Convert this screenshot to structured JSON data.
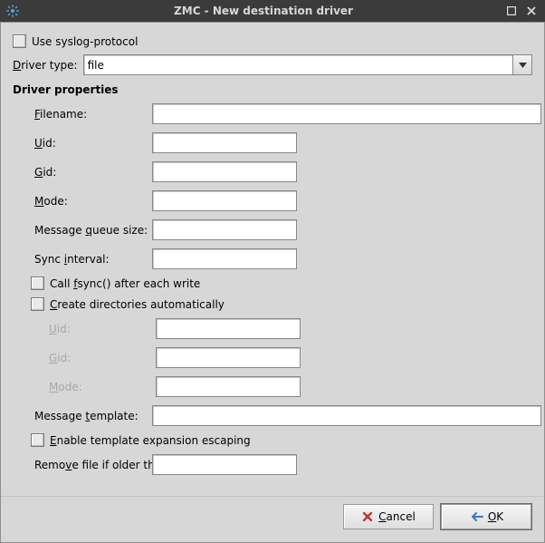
{
  "window": {
    "title": "ZMC - New destination driver"
  },
  "checkbox_syslog": "Use syslog-protocol",
  "driver_type": {
    "label_pre": "D",
    "label_post": "river type:",
    "value": "file"
  },
  "section": "Driver properties",
  "labels": {
    "filename_pre": "F",
    "filename_post": "ilename:",
    "uid_pre": "U",
    "uid_post": "id:",
    "gid_pre": "G",
    "gid_post": "id:",
    "mode_pre": "M",
    "mode_post": "ode:",
    "queue_pre": "Message ",
    "queue_mid": "q",
    "queue_post": "ueue size:",
    "sync_pre": "Sync ",
    "sync_mid": "i",
    "sync_post": "nterval:",
    "fsync_pre": "Call ",
    "fsync_mid": "f",
    "fsync_post": "sync() after each write",
    "createdirs_pre": "C",
    "createdirs_post": "reate directories automatically",
    "sub_uid_pre": "U",
    "sub_uid_post": "id:",
    "sub_gid_pre": "G",
    "sub_gid_post": "id:",
    "sub_mode_pre": "M",
    "sub_mode_post": "ode:",
    "template_pre": "Message ",
    "template_mid": "t",
    "template_post": "emplate:",
    "escape_pre": "E",
    "escape_post": "nable template expansion escaping",
    "remove_pre": "Remo",
    "remove_mid": "v",
    "remove_post": "e file if older than"
  },
  "values": {
    "filename": "",
    "uid": "",
    "gid": "",
    "mode": "",
    "queue": "",
    "sync": "",
    "sub_uid": "",
    "sub_gid": "",
    "sub_mode": "",
    "template": "",
    "remove": ""
  },
  "buttons": {
    "cancel_pre": "C",
    "cancel_post": "ancel",
    "ok_pre": "O",
    "ok_post": "K"
  }
}
